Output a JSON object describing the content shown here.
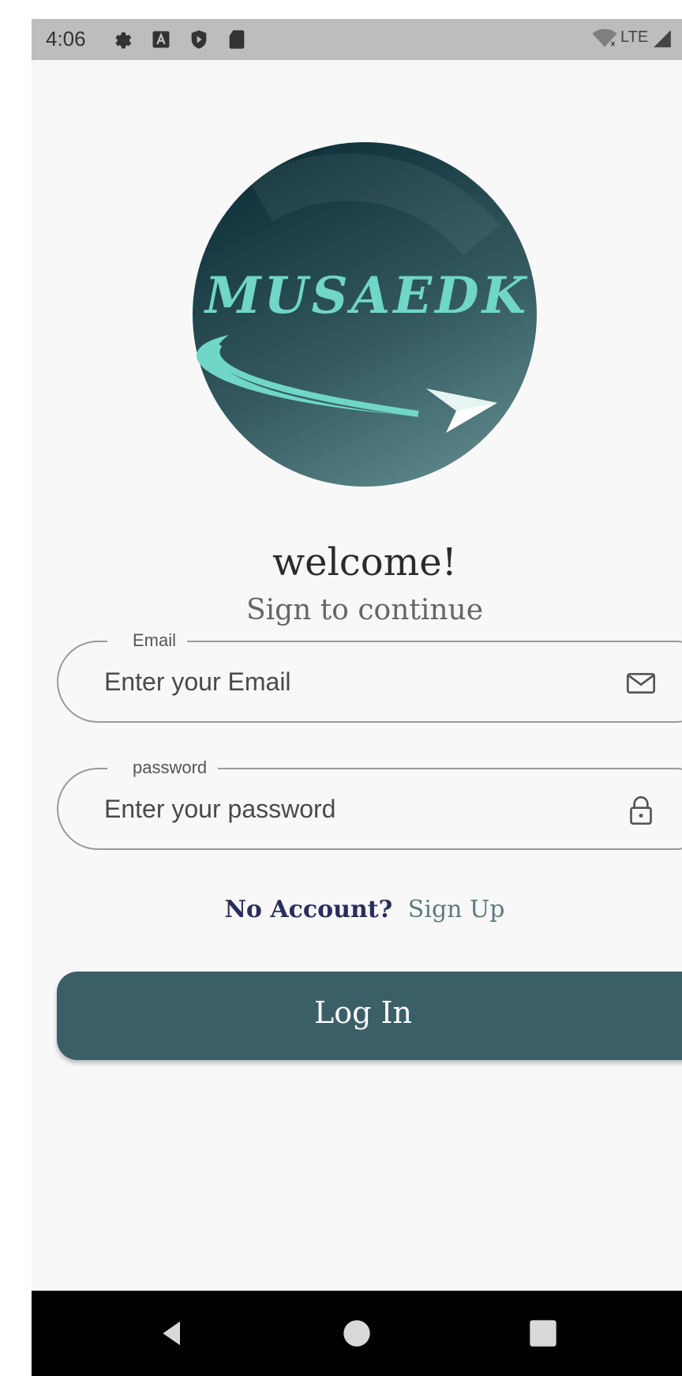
{
  "status_bar": {
    "time": "4:06",
    "network": "LTE",
    "icons": [
      "settings-icon",
      "a-icon",
      "shield-icon",
      "sd-card-icon",
      "wifi-icon",
      "signal-icon"
    ]
  },
  "logo": {
    "text": "MUSAEDK",
    "colors": {
      "circle": "#2f5b61",
      "accent": "#6fd6c8"
    }
  },
  "welcome": {
    "title": "welcome!",
    "subtitle": "Sign to continue"
  },
  "email_field": {
    "label": "Email",
    "placeholder": "Enter your Email",
    "icon": "mail-icon"
  },
  "password_field": {
    "label": "password",
    "placeholder": "Enter your password",
    "icon": "lock-icon"
  },
  "signup": {
    "prompt": "No Account?",
    "link": "Sign Up"
  },
  "login_button": {
    "label": "Log In",
    "color": "#3b5f66"
  },
  "nav_bar": {
    "icons": [
      "back-icon",
      "home-icon",
      "recents-icon"
    ]
  }
}
